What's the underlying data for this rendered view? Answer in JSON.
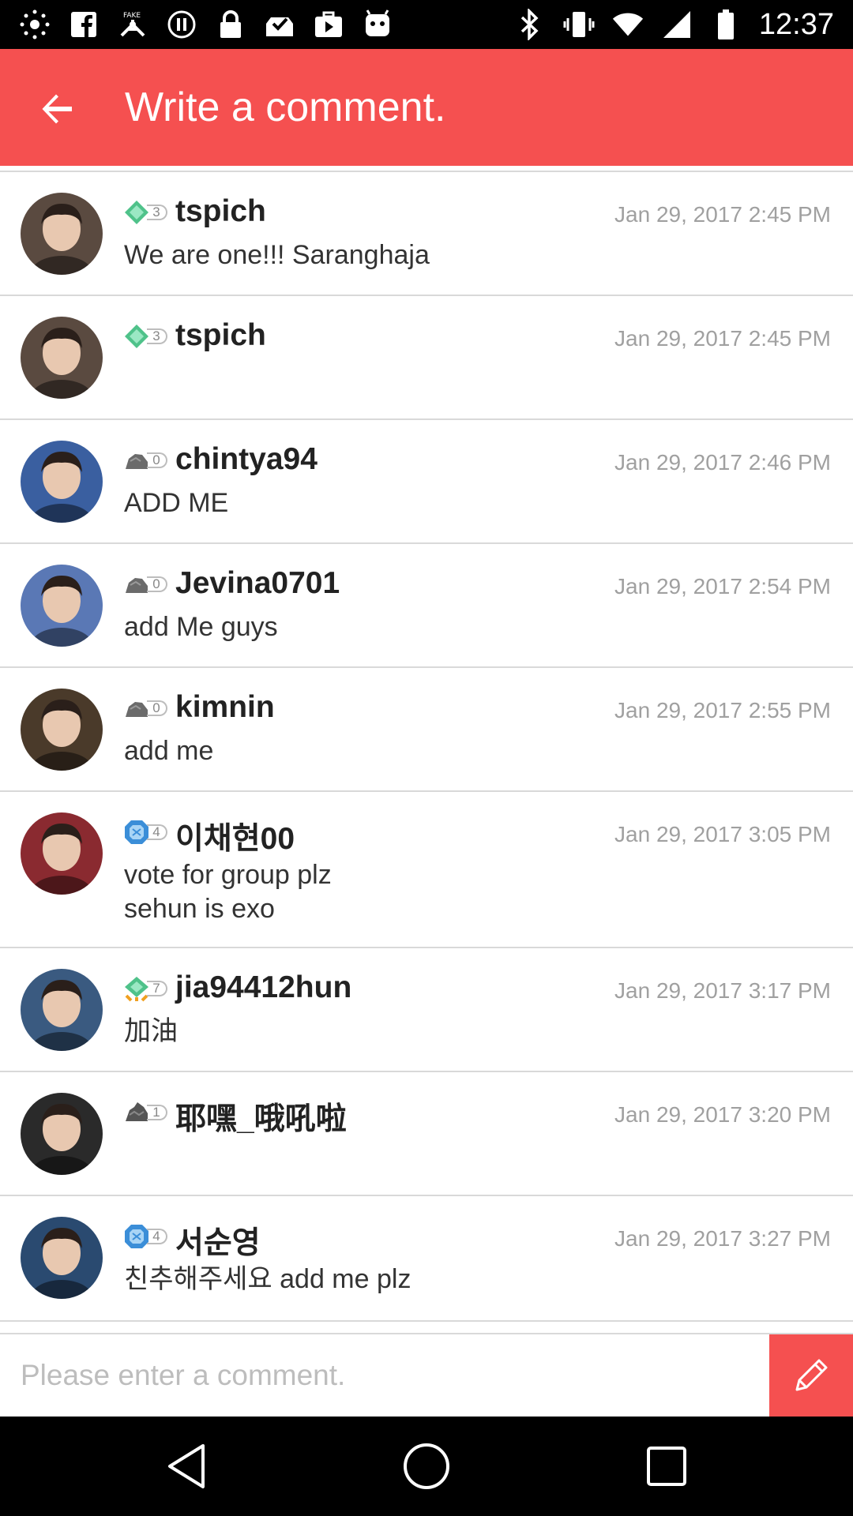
{
  "status_bar": {
    "time": "12:37",
    "icons": [
      "spinner-icon",
      "facebook-icon",
      "fake-gps-icon",
      "circle-pause-icon",
      "lock-icon",
      "inbox-check-icon",
      "play-store-icon",
      "android-head-icon",
      "bluetooth-icon",
      "vibrate-icon",
      "wifi-icon",
      "signal-icon",
      "battery-icon"
    ]
  },
  "app_bar": {
    "title": "Write a comment.",
    "background": "#f55050"
  },
  "comments": [
    {
      "username": "tspich",
      "level": "3",
      "badge": "green-gem",
      "time": "Jan 29, 2017 2:45 PM",
      "text": "We are one!!! Saranghaja",
      "avatar": "#5a4a40"
    },
    {
      "username": "tspich",
      "level": "3",
      "badge": "green-gem",
      "time": "Jan 29, 2017 2:45 PM",
      "text": "",
      "avatar": "#5a4a40"
    },
    {
      "username": "chintya94",
      "level": "0",
      "badge": "rock",
      "time": "Jan 29, 2017 2:46 PM",
      "text": "ADD ME",
      "avatar": "#3a5fa0"
    },
    {
      "username": "Jevina0701",
      "level": "0",
      "badge": "rock",
      "time": "Jan 29, 2017 2:54 PM",
      "text": "add Me guys",
      "avatar": "#5a78b5"
    },
    {
      "username": "kimnin",
      "level": "0",
      "badge": "rock",
      "time": "Jan 29, 2017 2:55 PM",
      "text": "add me",
      "avatar": "#4a3a2a"
    },
    {
      "username": "이채현00",
      "level": "4",
      "badge": "blue-gem",
      "time": "Jan 29, 2017 3:05 PM",
      "text": "vote for group plz\nsehun is exo",
      "avatar": "#8a2a30"
    },
    {
      "username": "jia94412hun",
      "level": "7",
      "badge": "green-gem-orange",
      "time": "Jan 29, 2017 3:17 PM",
      "text": "加油",
      "avatar": "#3a5a80"
    },
    {
      "username": "耶嘿_哦吼啦",
      "level": "1",
      "badge": "rock-dark",
      "time": "Jan 29, 2017 3:20 PM",
      "text": "",
      "avatar": "#2a2a2a"
    },
    {
      "username": "서순영",
      "level": "4",
      "badge": "blue-gem",
      "time": "Jan 29, 2017 3:27 PM",
      "text": "친추해주세요 add me plz",
      "avatar": "#2a4a70"
    }
  ],
  "input": {
    "placeholder": "Please enter a comment.",
    "value": ""
  },
  "nav": {
    "icons": [
      "back-triangle-icon",
      "home-circle-icon",
      "recents-square-icon"
    ]
  }
}
